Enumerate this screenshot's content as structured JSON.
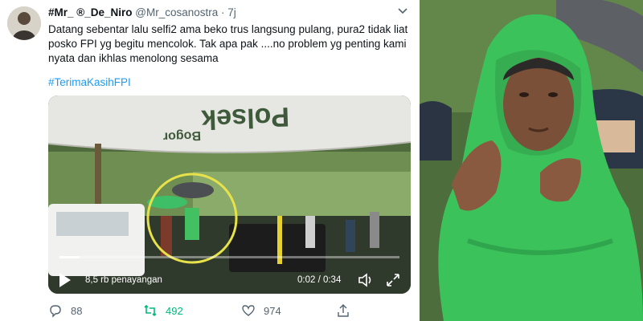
{
  "tweet": {
    "name": "#Mr_ ®_De_Niro",
    "handle": "@Mr_cosanostra",
    "time": "· 7j",
    "text": "Datang sebentar lalu selfi2 ama beko trus langsung pulang, pura2 tidak liat posko FPI yg begitu mencolok. Tak apa pak ....no problem  yg penting kami nyata dan ikhlas menolong sesama",
    "hashtag": "#TerimaKasihFPI",
    "menu_icon": "chevron-down-icon"
  },
  "video": {
    "banner_text": "Polsek",
    "banner_sub": "Bogor",
    "views": "8,5 rb penayangan",
    "timestamp": "0:02 / 0:34",
    "progress": 0.06,
    "highlight_color": "#e8e24a"
  },
  "actions": {
    "reply_count": "88",
    "retweet_count": "492",
    "like_count": "974"
  },
  "colors": {
    "link": "#1d9bf0",
    "retweet": "#00ba7c",
    "raincoat": "#3dc25a"
  }
}
